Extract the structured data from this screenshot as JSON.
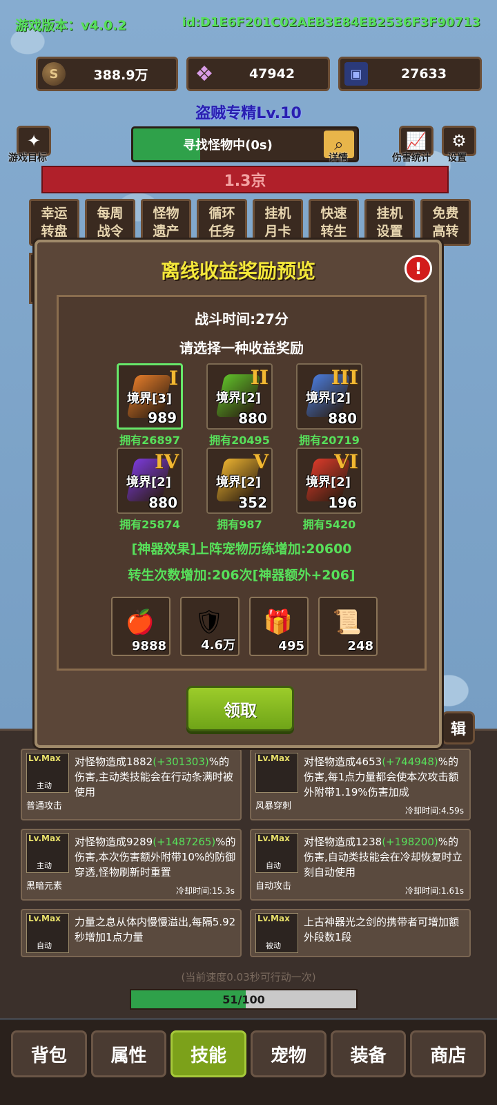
{
  "header": {
    "version": "游戏版本：v4.0.2",
    "id": "id:D1E6F201C02AEB3E84EB2536F3F90713"
  },
  "resources": [
    {
      "icon": "coin-icon",
      "value": "388.9万"
    },
    {
      "icon": "crystal-icon",
      "value": "47942"
    },
    {
      "icon": "card-icon",
      "value": "27633"
    }
  ],
  "player_title": "盗贼专精Lv.10",
  "top_buttons": {
    "goal": "游戏目标",
    "details": "详情",
    "damage_stats": "伤害统计",
    "settings": "设置"
  },
  "search": {
    "label": "寻找怪物中(0s)",
    "progress": 0.3
  },
  "monster_hp": "1.3京",
  "features": [
    {
      "l1": "幸运",
      "l2": "转盘"
    },
    {
      "l1": "每周",
      "l2": "战令"
    },
    {
      "l1": "怪物",
      "l2": "遗产"
    },
    {
      "l1": "循环",
      "l2": "任务"
    },
    {
      "l1": "挂机",
      "l2": "月卡"
    },
    {
      "l1": "快速",
      "l2": "转生"
    },
    {
      "l1": "挂机",
      "l2": "设置"
    },
    {
      "l1": "免费",
      "l2": "高转"
    }
  ],
  "modal": {
    "title": "离线收益奖励预览",
    "close_symbol": "!",
    "battle_time": "战斗时间:27分",
    "choose": "请选择一种收益奖励",
    "options": [
      {
        "roman": "I",
        "realm": "境界[3]",
        "count": "989",
        "own": "拥有26897",
        "color": "#e07a2a",
        "selected": true
      },
      {
        "roman": "II",
        "realm": "境界[2]",
        "count": "880",
        "own": "拥有20495",
        "color": "#5fbf2a",
        "selected": false
      },
      {
        "roman": "III",
        "realm": "境界[2]",
        "count": "880",
        "own": "拥有20719",
        "color": "#4a7ad8",
        "selected": false
      },
      {
        "roman": "IV",
        "realm": "境界[2]",
        "count": "880",
        "own": "拥有25874",
        "color": "#7a3ad8",
        "selected": false
      },
      {
        "roman": "V",
        "realm": "境界[2]",
        "count": "352",
        "own": "拥有987",
        "color": "#e8b030",
        "selected": false
      },
      {
        "roman": "VI",
        "realm": "境界[2]",
        "count": "196",
        "own": "拥有5420",
        "color": "#d83a2a",
        "selected": false
      }
    ],
    "effect1": "[神器效果]上阵宠物历练增加:20600",
    "effect2": "转生次数增加:206次[神器额外+206]",
    "items": [
      {
        "icon": "fruit-icon",
        "glyph": "🍎",
        "count": "9888"
      },
      {
        "icon": "shield-icon",
        "glyph": "🛡",
        "count": "4.6万"
      },
      {
        "icon": "chest-icon",
        "glyph": "🎁",
        "count": "495"
      },
      {
        "icon": "scroll-icon",
        "glyph": "📜",
        "count": "248"
      }
    ],
    "claim": "领取"
  },
  "edit_tab": "辑",
  "skills": [
    {
      "lv": "Lv.Max",
      "tag": "主动",
      "name": "普通攻击",
      "desc_a": "对怪物造成1882",
      "plus": "(+301303)",
      "desc_b": "%的伤害,主动类技能会在行动条满时被使用",
      "cd": ""
    },
    {
      "lv": "Lv.Max",
      "tag": "",
      "name": "风暴穿刺",
      "desc_a": "对怪物造成4653",
      "plus": "(+744948)",
      "desc_b": "%的伤害,每1点力量都会使本次攻击额外附带1.19%伤害加成",
      "cd": "冷却时间:4.59s"
    },
    {
      "lv": "Lv.Max",
      "tag": "主动",
      "name": "黑暗元素",
      "desc_a": "对怪物造成9289",
      "plus": "(+1487265)",
      "desc_b": "%的伤害,本次伤害额外附带10%的防御穿透,怪物刷新时重置",
      "cd": "冷却时间:15.3s"
    },
    {
      "lv": "Lv.Max",
      "tag": "自动",
      "name": "自动攻击",
      "desc_a": "对怪物造成1238",
      "plus": "(+198200)",
      "desc_b": "%的伤害,自动类技能会在冷却恢复时立刻自动使用",
      "cd": "冷却时间:1.61s"
    },
    {
      "lv": "Lv.Max",
      "tag": "自动",
      "name": "",
      "desc_a": "力量之息从体内慢慢溢出,每隔5.92秒增加1点力量",
      "plus": "",
      "desc_b": "",
      "cd": ""
    },
    {
      "lv": "Lv.Max",
      "tag": "被动",
      "name": "",
      "desc_a": "上古神器光之剑的携带者可增加额外段数1段",
      "plus": "",
      "desc_b": "",
      "cd": ""
    }
  ],
  "speed_note": "(当前速度0.03秒可行动一次)",
  "action_progress": {
    "label": "51/100",
    "value": 0.51
  },
  "nav": [
    {
      "label": "背包",
      "active": false
    },
    {
      "label": "属性",
      "active": false
    },
    {
      "label": "技能",
      "active": true
    },
    {
      "label": "宠物",
      "active": false
    },
    {
      "label": "装备",
      "active": false
    },
    {
      "label": "商店",
      "active": false
    }
  ]
}
